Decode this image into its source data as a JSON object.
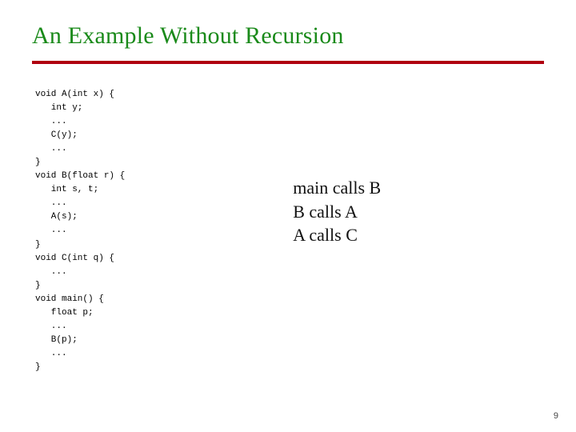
{
  "title": "An Example Without Recursion",
  "code": "void A(int x) {\n   int y;\n   ...\n   C(y);\n   ...\n}\nvoid B(float r) {\n   int s, t;\n   ...\n   A(s);\n   ...\n}\nvoid C(int q) {\n   ...\n}\nvoid main() {\n   float p;\n   ...\n   B(p);\n   ...\n}",
  "calls": {
    "line1": "main calls B",
    "line2": "B calls A",
    "line3": "A calls C"
  },
  "pagenum": "9"
}
